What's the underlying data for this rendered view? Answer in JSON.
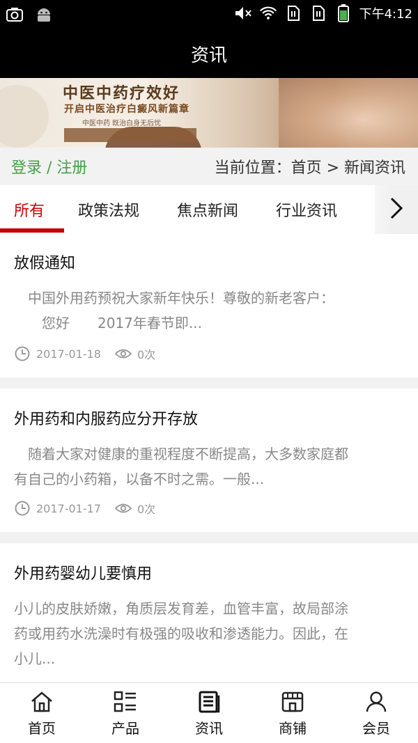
{
  "status_bar": {
    "time": "下午4:12",
    "icons": [
      "screenshot-icon",
      "android-icon",
      "mute-icon",
      "wifi-icon",
      "sim1-icon",
      "sim2-icon",
      "battery-icon"
    ]
  },
  "header": {
    "title": "资讯"
  },
  "banner": {
    "headline": "中医中药疗效好",
    "subheadline": "开启中医治疗白癜风新篇章",
    "small_text": "中医中药  既治白身无后忧"
  },
  "breadcrumb": {
    "login_label": "登录 / 注册",
    "location_text": "当前位置：首页 > 新闻资讯"
  },
  "tabs": [
    {
      "label": "所有",
      "active": true
    },
    {
      "label": "政策法规",
      "active": false
    },
    {
      "label": "焦点新闻",
      "active": false
    },
    {
      "label": "行业资讯",
      "active": false
    }
  ],
  "articles": [
    {
      "title": "放假通知",
      "body_line1": "　中国外用药预祝大家新年快乐！尊敬的新老客户：",
      "body_line2": "　　您好　　2017年春节即...",
      "date": "2017-01-18",
      "views": "0次"
    },
    {
      "title": "外用药和内服药应分开存放",
      "body_line1": "　随着大家对健康的重视程度不断提高，大多数家庭都",
      "body_line2": "有自己的小药箱，以备不时之需。一般...",
      "date": "2017-01-17",
      "views": "0次"
    },
    {
      "title": "外用药婴幼儿要慎用",
      "body_line1": "小儿的皮肤娇嫩，角质层发育差，血管丰富，故局部涂",
      "body_line2": "药或用药水洗澡时有极强的吸收和渗透能力。因此，在",
      "body_line3": "小儿..."
    }
  ],
  "bottom_nav": [
    {
      "label": "首页",
      "icon": "home-icon"
    },
    {
      "label": "产品",
      "icon": "product-list-icon"
    },
    {
      "label": "资讯",
      "icon": "news-icon"
    },
    {
      "label": "商铺",
      "icon": "shop-icon"
    },
    {
      "label": "会员",
      "icon": "member-icon"
    }
  ],
  "colors": {
    "header_bg": "#000000",
    "login_green": "#43a047",
    "active_tab_red": "#d10000",
    "text_gray": "#888888"
  }
}
